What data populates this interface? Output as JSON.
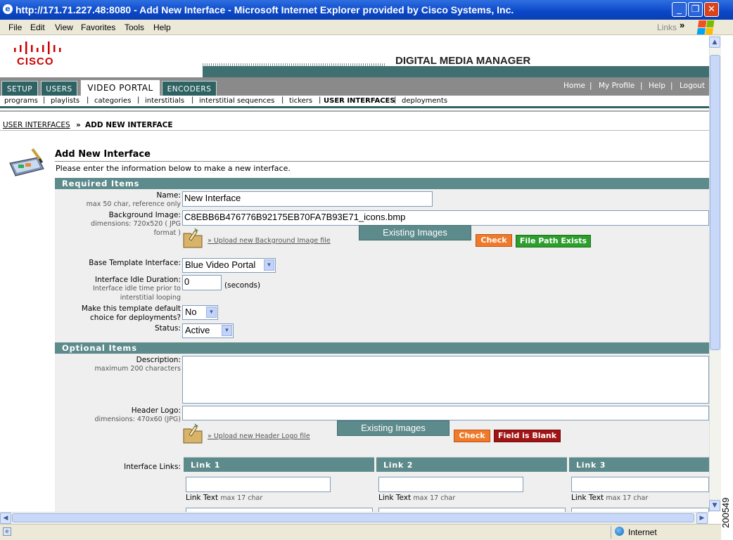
{
  "window": {
    "title": "http://171.71.227.48:8080 - Add New Interface - Microsoft Internet Explorer provided by Cisco Systems, Inc."
  },
  "menu": [
    {
      "label": "File"
    },
    {
      "label": "Edit"
    },
    {
      "label": "View"
    },
    {
      "label": "Favorites"
    },
    {
      "label": "Tools"
    },
    {
      "label": "Help"
    }
  ],
  "links_label": "Links",
  "logo": {
    "text": "CISCO"
  },
  "app_title": "DIGITAL MEDIA MANAGER",
  "main_tabs": [
    "SETUP",
    "USERS",
    "VIDEO PORTAL",
    "ENCODERS"
  ],
  "active_tab": "VIDEO PORTAL",
  "top_links": [
    "Home",
    "My Profile",
    "Help",
    "Logout"
  ],
  "sub_nav": [
    "programs",
    "playlists",
    "categories",
    "interstitials",
    "interstitial sequences",
    "tickers",
    "USER INTERFACES",
    "deployments"
  ],
  "breadcrumb": {
    "parent": "USER INTERFACES",
    "separator": "»",
    "current": "ADD NEW INTERFACE"
  },
  "heading": "Add New Interface",
  "intro": "Please enter the information below to make a new interface.",
  "required_section": "Required Items",
  "fields": {
    "name": {
      "label": "Name:",
      "hint": "max 50 char, reference only",
      "value": "New Interface"
    },
    "background": {
      "label": "Background Image:",
      "hint1": "dimensions: 720x520 ( JPG",
      "hint2": "format )",
      "value": "C8EBB6B476776B92175EB70FA7B93E71_icons.bmp",
      "upload": "» Upload new Background Image file",
      "existing": "Existing Images",
      "check": "Check",
      "status": "File Path Exists"
    },
    "template": {
      "label": "Base Template Interface:",
      "value": "Blue Video Portal"
    },
    "idle": {
      "label": "Interface Idle Duration:",
      "hint1": "Interface idle time prior to",
      "hint2": "interstitial looping",
      "value": "0",
      "unit": "(seconds)"
    },
    "default": {
      "label1": "Make this template default",
      "label2": "choice for deployments?",
      "value": "No"
    },
    "status": {
      "label": "Status:",
      "value": "Active"
    }
  },
  "optional_section": "Optional Items",
  "optional": {
    "description": {
      "label": "Description:",
      "hint": "maximum 200 characters",
      "value": ""
    },
    "header_logo": {
      "label": "Header Logo:",
      "hint": "dimensions: 470x60 (JPG)",
      "value": "",
      "upload": "» Upload new Header Logo file",
      "existing": "Existing Images",
      "check": "Check",
      "status": "Field is Blank"
    },
    "links_label": "Interface Links:",
    "link_columns": [
      "Link 1",
      "Link 2",
      "Link 3"
    ],
    "link_text_caption": "Link Text",
    "link_text_hint": "max 17 char"
  },
  "status_bar": {
    "zone": "Internet"
  },
  "figure_id": "200549",
  "colors": {
    "teal": "#5d8a8b",
    "dark_teal": "#2e6263",
    "check": "#f07a2a",
    "ok": "#2b9e2b",
    "error": "#a01414",
    "cisco_red": "#cc0000"
  }
}
